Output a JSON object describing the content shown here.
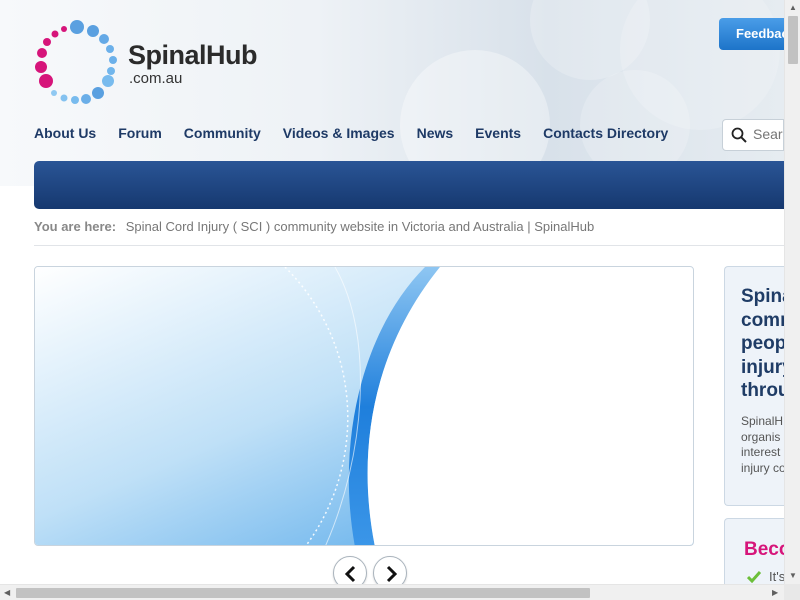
{
  "header": {
    "logo_text": "SpinalHub",
    "logo_sub": ".com.au",
    "feedback_label": "Feedback"
  },
  "nav": {
    "items": [
      {
        "label": "About Us"
      },
      {
        "label": "Forum"
      },
      {
        "label": "Community"
      },
      {
        "label": "Videos & Images"
      },
      {
        "label": "News"
      },
      {
        "label": "Events"
      },
      {
        "label": "Contacts Directory"
      }
    ]
  },
  "search": {
    "placeholder": "Search"
  },
  "breadcrumb": {
    "label": "You are here:",
    "current": "Spinal Cord Injury ( SCI ) community website in Victoria and Australia | SpinalHub"
  },
  "side_panel": {
    "title_lines": [
      "Spina",
      "comm",
      "peop",
      "injury",
      "throu"
    ],
    "body_lines": [
      "SpinalH",
      "organis",
      "interest",
      "injury co"
    ]
  },
  "side_panel2": {
    "title": "Beco",
    "item": "It's"
  },
  "colors": {
    "nav_text": "#1e3a66",
    "feedback_bg": "#2a85d8",
    "blue_bar": "#1f4682",
    "accent_magenta": "#d6157a",
    "check_green": "#6cbf3a"
  },
  "icons": {
    "search": "search-icon",
    "prev": "chevron-left-icon",
    "next": "chevron-right-icon",
    "check": "check-icon"
  }
}
